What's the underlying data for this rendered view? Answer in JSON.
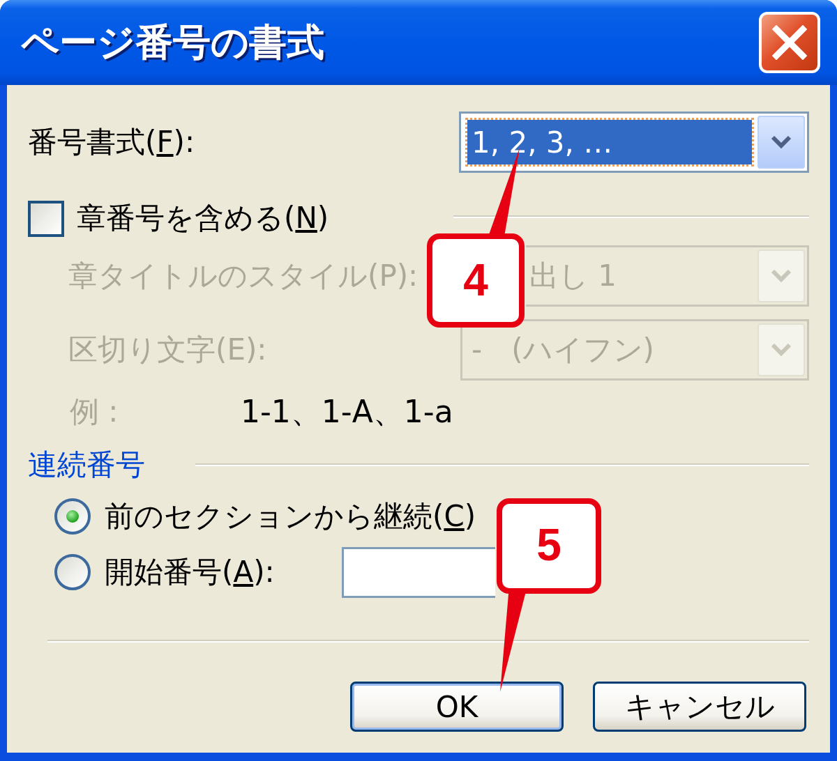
{
  "window": {
    "title": "ページ番号の書式"
  },
  "number_format": {
    "label": "番号書式(F):",
    "mnemonic_underlined": true,
    "value": "1, 2, 3, …",
    "focused": true,
    "callout": "4"
  },
  "include_chapter_number": {
    "label": "章番号を含める(N)",
    "mnemonic_underlined": true,
    "checked": false
  },
  "chapter_style": {
    "label": "章タイトルのスタイル(P):",
    "value": "出し 1",
    "disabled": true
  },
  "separator_char": {
    "label": "区切り文字(E):",
    "value": "-　(ハイフン)",
    "disabled": true
  },
  "example": {
    "label": "例 :",
    "value": "1-1、1-A、1-a",
    "disabled": true
  },
  "page_numbering": {
    "heading": "連続番号",
    "options": [
      {
        "kind": "plain",
        "label": "前のセクションから継続(C)",
        "mnemonic_underlined": true,
        "selected": true
      },
      {
        "kind": "with-input",
        "label": "開始番号(A):",
        "mnemonic_underlined": true,
        "selected": false
      }
    ]
  },
  "buttons": [
    {
      "label": "OK",
      "default": true,
      "callout": "5"
    },
    {
      "label": "キャンセル",
      "default": false
    }
  ]
}
